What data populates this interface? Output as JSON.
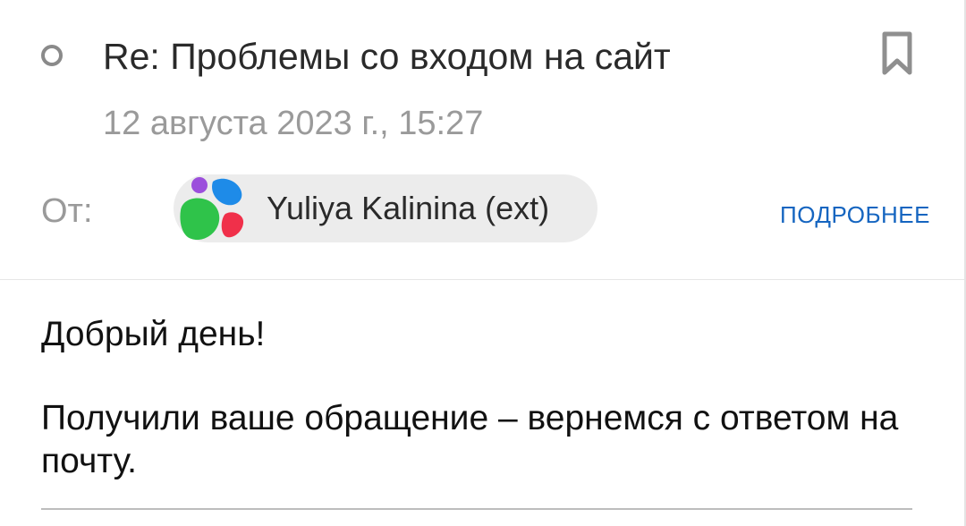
{
  "header": {
    "subject": "Re: Проблемы со входом на сайт",
    "date": "12 августа 2023 г., 15:27",
    "from_label": "От:",
    "sender_name": "Yuliya Kalinina (ext)",
    "details_label": "ПОДРОБНЕЕ"
  },
  "body": {
    "greeting": "Добрый день!",
    "message": "Получили ваше обращение – вернемся с ответом на почту."
  },
  "colors": {
    "link": "#1565c0",
    "muted_text": "#9a9a9a",
    "chip_background": "#ececec"
  },
  "icons": {
    "unread": "unread-indicator-icon",
    "bookmark": "bookmark-icon",
    "avatar": "sender-avatar-logo"
  }
}
